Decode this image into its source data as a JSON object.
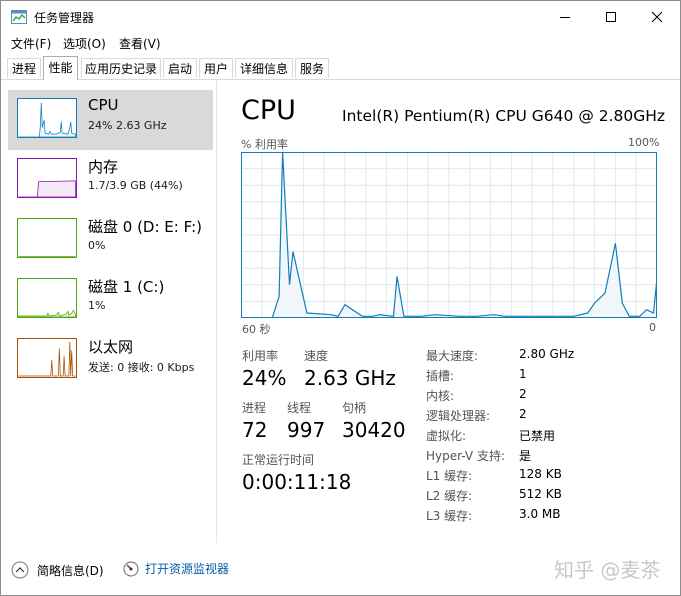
{
  "window": {
    "title": "任务管理器"
  },
  "menu": [
    "文件(F)",
    "选项(O)",
    "查看(V)"
  ],
  "tabs": [
    "进程",
    "性能",
    "应用历史记录",
    "启动",
    "用户",
    "详细信息",
    "服务"
  ],
  "active_tab": "性能",
  "sidebar": [
    {
      "name": "CPU",
      "sub": "24% 2.63 GHz",
      "color": "#117dbb",
      "selected": true
    },
    {
      "name": "内存",
      "sub": "1.7/3.9 GB (44%)",
      "color": "#8b12ae",
      "selected": false
    },
    {
      "name": "磁盘 0 (D: E: F:)",
      "sub": "0%",
      "color": "#4da60c",
      "selected": false
    },
    {
      "name": "磁盘 1 (C:)",
      "sub": "1%",
      "color": "#4da60c",
      "selected": false
    },
    {
      "name": "以太网",
      "sub": "发送: 0 接收: 0 Kbps",
      "color": "#a74f01",
      "selected": false
    }
  ],
  "main": {
    "title": "CPU",
    "model": "Intel(R) Pentium(R) CPU G640 @ 2.80GHz",
    "axis_top_left": "% 利用率",
    "axis_top_right": "100%",
    "axis_bottom_left": "60 秒",
    "axis_bottom_right": "0",
    "stats": {
      "utilization_label": "利用率",
      "utilization_value": "24%",
      "speed_label": "速度",
      "speed_value": "2.63 GHz",
      "processes_label": "进程",
      "processes_value": "72",
      "threads_label": "线程",
      "threads_value": "997",
      "handles_label": "句柄",
      "handles_value": "30420",
      "uptime_label": "正常运行时间",
      "uptime_value": "0:00:11:18"
    },
    "specs": [
      {
        "label": "最大速度:",
        "value": "2.80 GHz"
      },
      {
        "label": "插槽:",
        "value": "1"
      },
      {
        "label": "内核:",
        "value": "2"
      },
      {
        "label": "逻辑处理器:",
        "value": "2"
      },
      {
        "label": "虚拟化:",
        "value": "已禁用"
      },
      {
        "label": "Hyper-V 支持:",
        "value": "是"
      },
      {
        "label": "L1 缓存:",
        "value": "128 KB"
      },
      {
        "label": "L2 缓存:",
        "value": "512 KB"
      },
      {
        "label": "L3 缓存:",
        "value": "3.0 MB"
      }
    ]
  },
  "footer": {
    "brief": "简略信息(D)",
    "monitor_link": "打开资源监视器",
    "watermark": "知乎 @麦茶"
  },
  "chart_data": {
    "type": "area",
    "x": [
      60,
      55.5,
      54.5,
      54,
      53,
      52.5,
      50.5,
      47,
      46,
      45,
      42.5,
      41,
      40,
      38,
      37.5,
      36.5,
      34,
      32,
      28.5,
      26,
      23.5,
      22,
      20.5,
      17.5,
      14.5,
      12,
      10,
      9,
      7.5,
      6,
      5,
      4,
      2.5,
      2,
      1.5,
      0.5,
      0
    ],
    "values": [
      0,
      0,
      13,
      100,
      20,
      40,
      3,
      2,
      1,
      8,
      1,
      1,
      2,
      1,
      25,
      1,
      1,
      2,
      1,
      1,
      2,
      1,
      1,
      1,
      1,
      1,
      3,
      9,
      15,
      45,
      9,
      1,
      1,
      3,
      5,
      3,
      24
    ],
    "xlabel": "60 秒",
    "ylim": [
      0,
      100
    ],
    "xlim": [
      60,
      0
    ],
    "ylabel": "% 利用率",
    "color": "#117dbb",
    "grid": true
  }
}
